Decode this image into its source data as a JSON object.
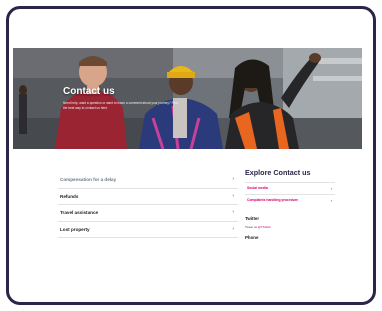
{
  "hero": {
    "title": "Contact us",
    "subtitle": "Need help, want a question or want to leave a comment about your journey? Find the best way to contact us here."
  },
  "help_topics": [
    {
      "label": "Compensation for a delay"
    },
    {
      "label": "Refunds"
    },
    {
      "label": "Travel assistance"
    },
    {
      "label": "Lost property"
    }
  ],
  "explore": {
    "title": "Explore Contact us",
    "links": [
      {
        "label": "Social media"
      },
      {
        "label": "Complaints handling procedure"
      }
    ]
  },
  "twitter": {
    "heading": "Twitter",
    "text": "Tweet us",
    "handle": "@TfLRail"
  },
  "phone": {
    "heading": "Phone"
  },
  "colors": {
    "frame": "#2b2548",
    "accent": "#d1006a",
    "heading": "#2b2548"
  }
}
